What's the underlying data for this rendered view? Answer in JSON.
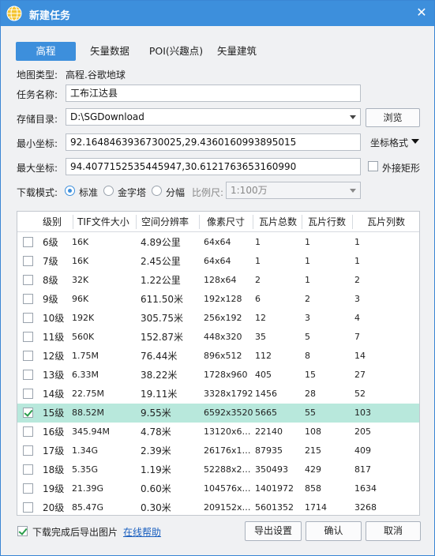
{
  "window": {
    "title": "新建任务",
    "close_icon": "close-icon",
    "logo_icon": "globe-icon"
  },
  "tabs": [
    {
      "label": "高程",
      "active": true
    },
    {
      "label": "矢量数据",
      "active": false
    },
    {
      "label": "POI(兴趣点)",
      "active": false
    },
    {
      "label": "矢量建筑",
      "active": false
    }
  ],
  "map_type": {
    "label": "地图类型:",
    "value": "高程.谷歌地球"
  },
  "task_name": {
    "label": "任务名称:",
    "value": "工布江达县"
  },
  "storage": {
    "label": "存储目录:",
    "value": "D:\\SGDownload",
    "browse_label": "浏览"
  },
  "min_coord": {
    "label": "最小坐标:",
    "value": "92.1648463936730025,29.4360160993895015",
    "format_label": "坐标格式"
  },
  "max_coord": {
    "label": "最大坐标:",
    "value": "94.4077152535445947,30.6121763653160990",
    "bbox_label": "外接矩形",
    "bbox_checked": false
  },
  "download_mode": {
    "label": "下载模式:",
    "options": [
      {
        "label": "标准",
        "selected": true
      },
      {
        "label": "金字塔",
        "selected": false
      },
      {
        "label": "分幅",
        "selected": false
      }
    ],
    "scale_label": "比例尺:",
    "scale_value": "1:100万"
  },
  "table": {
    "columns": [
      "级别",
      "TIF文件大小",
      "空间分辨率",
      "像素尺寸",
      "瓦片总数",
      "瓦片行数",
      "瓦片列数"
    ],
    "rows": [
      {
        "level": "6级",
        "size": "16K",
        "res": "4.89公里",
        "pixels": "64x64",
        "total": "1",
        "rows": "1",
        "cols": "1",
        "checked": false
      },
      {
        "level": "7级",
        "size": "16K",
        "res": "2.45公里",
        "pixels": "64x64",
        "total": "1",
        "rows": "1",
        "cols": "1",
        "checked": false
      },
      {
        "level": "8级",
        "size": "32K",
        "res": "1.22公里",
        "pixels": "128x64",
        "total": "2",
        "rows": "1",
        "cols": "2",
        "checked": false
      },
      {
        "level": "9级",
        "size": "96K",
        "res": "611.50米",
        "pixels": "192x128",
        "total": "6",
        "rows": "2",
        "cols": "3",
        "checked": false
      },
      {
        "level": "10级",
        "size": "192K",
        "res": "305.75米",
        "pixels": "256x192",
        "total": "12",
        "rows": "3",
        "cols": "4",
        "checked": false
      },
      {
        "level": "11级",
        "size": "560K",
        "res": "152.87米",
        "pixels": "448x320",
        "total": "35",
        "rows": "5",
        "cols": "7",
        "checked": false
      },
      {
        "level": "12级",
        "size": "1.75M",
        "res": "76.44米",
        "pixels": "896x512",
        "total": "112",
        "rows": "8",
        "cols": "14",
        "checked": false
      },
      {
        "level": "13级",
        "size": "6.33M",
        "res": "38.22米",
        "pixels": "1728x960",
        "total": "405",
        "rows": "15",
        "cols": "27",
        "checked": false
      },
      {
        "level": "14级",
        "size": "22.75M",
        "res": "19.11米",
        "pixels": "3328x1792",
        "total": "1456",
        "rows": "28",
        "cols": "52",
        "checked": false
      },
      {
        "level": "15级",
        "size": "88.52M",
        "res": "9.55米",
        "pixels": "6592x3520",
        "total": "5665",
        "rows": "55",
        "cols": "103",
        "checked": true
      },
      {
        "level": "16级",
        "size": "345.94M",
        "res": "4.78米",
        "pixels": "13120x6…",
        "total": "22140",
        "rows": "108",
        "cols": "205",
        "checked": false
      },
      {
        "level": "17级",
        "size": "1.34G",
        "res": "2.39米",
        "pixels": "26176x1…",
        "total": "87935",
        "rows": "215",
        "cols": "409",
        "checked": false
      },
      {
        "level": "18级",
        "size": "5.35G",
        "res": "1.19米",
        "pixels": "52288x2…",
        "total": "350493",
        "rows": "429",
        "cols": "817",
        "checked": false
      },
      {
        "level": "19级",
        "size": "21.39G",
        "res": "0.60米",
        "pixels": "104576x…",
        "total": "1401972",
        "rows": "858",
        "cols": "1634",
        "checked": false
      },
      {
        "level": "20级",
        "size": "85.47G",
        "res": "0.30米",
        "pixels": "209152x…",
        "total": "5601352",
        "rows": "1714",
        "cols": "3268",
        "checked": false
      }
    ]
  },
  "footer": {
    "export_after_label": "下载完成后导出图片",
    "export_after_checked": true,
    "help_link": "在线帮助",
    "export_settings": "导出设置",
    "confirm": "确认",
    "cancel": "取消"
  },
  "colors": {
    "accent": "#3d8fdc",
    "selected_row": "#b8e8dc",
    "check": "#2a9d4b",
    "link": "#1a5fbf"
  }
}
